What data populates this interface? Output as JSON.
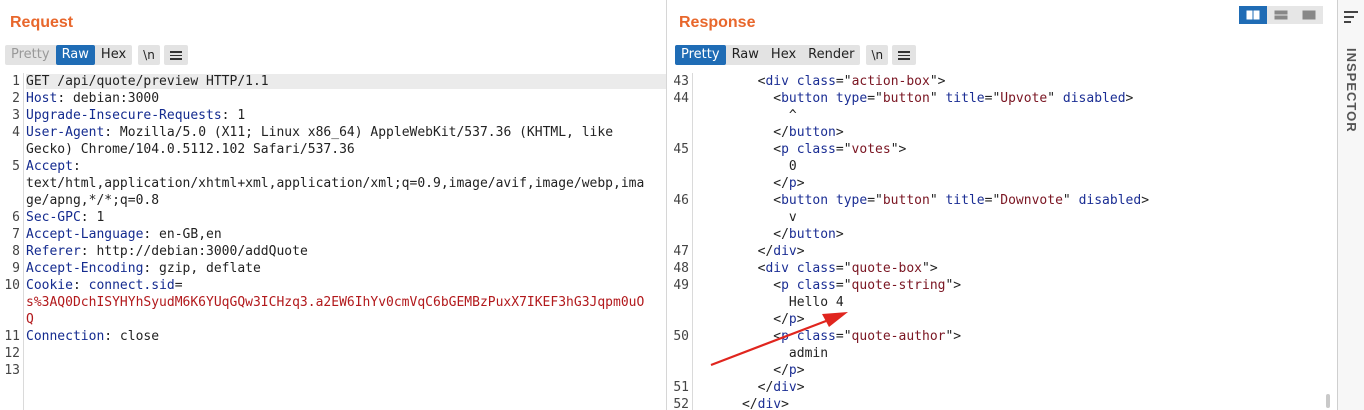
{
  "request": {
    "title": "Request",
    "tabs": [
      "Pretty",
      "Raw",
      "Hex"
    ],
    "active_tab": "Raw",
    "newline_label": "\\n",
    "lines": [
      {
        "n": "1",
        "html": "<span class=\"hl\">GET /api/quote/preview HTTP/1.1                                                          </span>"
      },
      {
        "n": "2",
        "html": "<span class=\"k\">Host</span>: debian:3000"
      },
      {
        "n": "3",
        "html": "<span class=\"k\">Upgrade-Insecure-Requests</span>: 1"
      },
      {
        "n": "4",
        "html": "<span class=\"k\">User-Agent</span>: Mozilla/5.0 (X11; Linux x86_64) AppleWebKit/537.36 (KHTML, like"
      },
      {
        "n": "",
        "html": "Gecko) Chrome/104.0.5112.102 Safari/537.36"
      },
      {
        "n": "5",
        "html": "<span class=\"k\">Accept</span>:"
      },
      {
        "n": "",
        "html": "text/html,application/xhtml+xml,application/xml;q=0.9,image/avif,image/webp,ima"
      },
      {
        "n": "",
        "html": "ge/apng,*/*;q=0.8"
      },
      {
        "n": "6",
        "html": "<span class=\"k\">Sec-GPC</span>: 1"
      },
      {
        "n": "7",
        "html": "<span class=\"k\">Accept-Language</span>: en-GB,en"
      },
      {
        "n": "8",
        "html": "<span class=\"k\">Referer</span>: http://debian:3000/addQuote"
      },
      {
        "n": "9",
        "html": "<span class=\"k\">Accept-Encoding</span>: gzip, deflate"
      },
      {
        "n": "10",
        "html": "<span class=\"k\">Cookie</span>: <span class=\"k\">connect.sid</span>="
      },
      {
        "n": "",
        "html": "<span class=\"c\">s%3AQ0DchISYHYhSyudM6K6YUqGQw3ICHzq3.a2EW6IhYv0cmVqC6bGEMBzPuxX7IKEF3hG3Jqpm0uO</span>"
      },
      {
        "n": "",
        "html": "<span class=\"c\">Q</span>"
      },
      {
        "n": "11",
        "html": "<span class=\"k\">Connection</span>: close"
      },
      {
        "n": "12",
        "html": ""
      },
      {
        "n": "13",
        "html": ""
      }
    ]
  },
  "response": {
    "title": "Response",
    "tabs": [
      "Pretty",
      "Raw",
      "Hex",
      "Render"
    ],
    "active_tab": "Pretty",
    "newline_label": "\\n",
    "lines": [
      {
        "n": "43",
        "html": "        &lt;<span class=\"t\">div</span> <span class=\"a\">class</span>=\"<span class=\"v\">action-box</span>\"&gt;"
      },
      {
        "n": "44",
        "html": "          &lt;<span class=\"t\">button</span> <span class=\"a\">type</span>=\"<span class=\"v\">button</span>\" <span class=\"a\">title</span>=\"<span class=\"v\">Upvote</span>\" <span class=\"a\">disabled</span>&gt;"
      },
      {
        "n": "",
        "html": "            ^"
      },
      {
        "n": "",
        "html": "          &lt;/<span class=\"t\">button</span>&gt;"
      },
      {
        "n": "45",
        "html": "          &lt;<span class=\"t\">p</span> <span class=\"a\">class</span>=\"<span class=\"v\">votes</span>\"&gt;"
      },
      {
        "n": "",
        "html": "            0"
      },
      {
        "n": "",
        "html": "          &lt;/<span class=\"t\">p</span>&gt;"
      },
      {
        "n": "46",
        "html": "          &lt;<span class=\"t\">button</span> <span class=\"a\">type</span>=\"<span class=\"v\">button</span>\" <span class=\"a\">title</span>=\"<span class=\"v\">Downvote</span>\" <span class=\"a\">disabled</span>&gt;"
      },
      {
        "n": "",
        "html": "            v"
      },
      {
        "n": "",
        "html": "          &lt;/<span class=\"t\">button</span>&gt;"
      },
      {
        "n": "47",
        "html": "        &lt;/<span class=\"t\">div</span>&gt;"
      },
      {
        "n": "48",
        "html": "        &lt;<span class=\"t\">div</span> <span class=\"a\">class</span>=\"<span class=\"v\">quote-box</span>\"&gt;"
      },
      {
        "n": "49",
        "html": "          &lt;<span class=\"t\">p</span> <span class=\"a\">class</span>=\"<span class=\"v\">quote-string</span>\"&gt;"
      },
      {
        "n": "",
        "html": "            Hello 4"
      },
      {
        "n": "",
        "html": "          &lt;/<span class=\"t\">p</span>&gt;"
      },
      {
        "n": "50",
        "html": "          &lt;<span class=\"t\">p</span> <span class=\"a\">class</span>=\"<span class=\"v\">quote-author</span>\"&gt;"
      },
      {
        "n": "",
        "html": "            admin"
      },
      {
        "n": "",
        "html": "          &lt;/<span class=\"t\">p</span>&gt;"
      },
      {
        "n": "51",
        "html": "        &lt;/<span class=\"t\">div</span>&gt;"
      },
      {
        "n": "52",
        "html": "      &lt;/<span class=\"t\">div</span>&gt;"
      }
    ]
  },
  "view_toggle": {
    "icons": [
      "split-horizontal-icon",
      "split-vertical-icon",
      "single-pane-icon"
    ],
    "active": 0
  },
  "inspector": {
    "label": "INSPECTOR"
  },
  "colors": {
    "accent": "#1f6cb5",
    "title": "#e8672c",
    "arrow": "#e0251e"
  }
}
